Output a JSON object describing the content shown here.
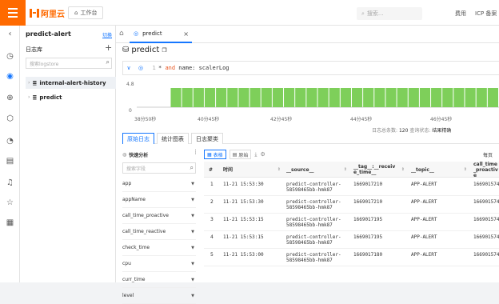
{
  "topbar": {
    "brand": "阿里云",
    "workbench": "工作台",
    "search_placeholder": "搜索...",
    "fee": "费用",
    "icp": "ICP 备案"
  },
  "sidepanel": {
    "title": "predict-alert",
    "switch": "切换",
    "logstores_label": "日志库",
    "search_placeholder": "搜索logstore",
    "items": [
      {
        "label": "internal-alert-history"
      },
      {
        "label": "predict"
      }
    ]
  },
  "tabs": {
    "active_tab": "predict"
  },
  "query": {
    "logstore_title": "predict",
    "line_number": "1",
    "text_prefix": "* ",
    "keyword": "and",
    "text_suffix": " name: scalerLog"
  },
  "histogram": {
    "y_max_label": "4.8",
    "y_min_label": "0",
    "x_ticks": [
      "38分50秒",
      "40分45秒",
      "42分45秒",
      "44分45秒",
      "46分45秒"
    ],
    "bar_levels": [
      0,
      0,
      0,
      1,
      1,
      1,
      1,
      1,
      1,
      1,
      1,
      1,
      1,
      1,
      1,
      1,
      1,
      1,
      1,
      1,
      1,
      1,
      1,
      1,
      1,
      1,
      1,
      1,
      1,
      1,
      1,
      1
    ],
    "bar_color": "#7ecf5a"
  },
  "stats": {
    "count_label": "日志总条数:",
    "count_value": "120",
    "status_label": "查询状态:",
    "status_value": "结果精确"
  },
  "subtabs": [
    "原始日志",
    "统计图表",
    "日志聚类"
  ],
  "quick_analysis": {
    "title": "快速分析",
    "search_placeholder": "搜索字段",
    "fields": [
      "app",
      "appName",
      "call_time_proactive",
      "call_time_reactive",
      "check_time",
      "cpu",
      "curr_time",
      "level"
    ]
  },
  "toolbar": {
    "table_label": "表格",
    "raw_label": "原始",
    "right_text": "每页"
  },
  "table": {
    "columns": [
      "#",
      "时间",
      "__source__",
      "__tag__:__receive_time__",
      "__topic__",
      "call_time_proactive"
    ],
    "rows": [
      {
        "num": "1",
        "time": "11-21 15:53:30",
        "source": "predict-controller-58598465bb-hmk87",
        "tag": "1669017210",
        "topic": "APP-ALERT",
        "call": "1669015740"
      },
      {
        "num": "2",
        "time": "11-21 15:53:30",
        "source": "predict-controller-58598465bb-hmk87",
        "tag": "1669017210",
        "topic": "APP-ALERT",
        "call": "1669015740"
      },
      {
        "num": "3",
        "time": "11-21 15:53:15",
        "source": "predict-controller-58598465bb-hmk87",
        "tag": "1669017195",
        "topic": "APP-ALERT",
        "call": "1669015740"
      },
      {
        "num": "4",
        "time": "11-21 15:53:15",
        "source": "predict-controller-58598465bb-hmk87",
        "tag": "1669017195",
        "topic": "APP-ALERT",
        "call": "1669015740"
      },
      {
        "num": "5",
        "time": "11-21 15:53:00",
        "source": "predict-controller-58598465bb-hmk87",
        "tag": "1669017180",
        "topic": "APP-ALERT",
        "call": "1669015740"
      }
    ]
  },
  "colors": {
    "accent": "#1677ff",
    "brand": "#ff6a00"
  }
}
